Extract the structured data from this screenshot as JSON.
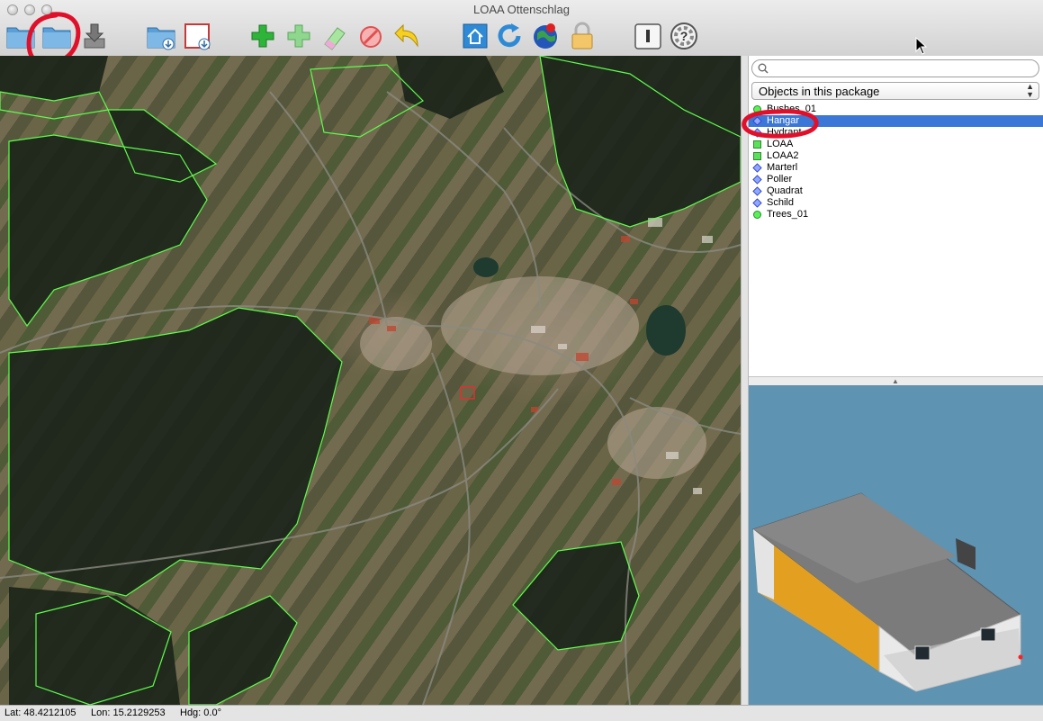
{
  "window": {
    "title": "LOAA Ottenschlag"
  },
  "toolbar": {
    "buttons": [
      {
        "name": "open-folder-icon"
      },
      {
        "name": "open-package-folder-icon"
      },
      {
        "name": "save-download-icon"
      },
      {
        "name": "import-folder-icon"
      },
      {
        "name": "import-frame-icon"
      },
      {
        "name": "add-object-icon"
      },
      {
        "name": "add-multiple-icon"
      },
      {
        "name": "edit-eraser-icon"
      },
      {
        "name": "delete-icon"
      },
      {
        "name": "undo-icon"
      },
      {
        "name": "home-icon"
      },
      {
        "name": "refresh-icon"
      },
      {
        "name": "globe-icon"
      },
      {
        "name": "lock-icon"
      },
      {
        "name": "preferences-icon"
      },
      {
        "name": "help-icon"
      }
    ]
  },
  "search": {
    "placeholder": "",
    "value": ""
  },
  "package_filter": {
    "selected": "Objects in this package"
  },
  "objects": [
    {
      "label": "Bushes_01",
      "type": "pin",
      "selected": false
    },
    {
      "label": "Hangar",
      "type": "dia",
      "selected": true
    },
    {
      "label": "Hydrant",
      "type": "dia",
      "selected": false
    },
    {
      "label": "LOAA",
      "type": "sq",
      "selected": false
    },
    {
      "label": "LOAA2",
      "type": "sq",
      "selected": false
    },
    {
      "label": "Marterl",
      "type": "dia",
      "selected": false
    },
    {
      "label": "Poller",
      "type": "dia",
      "selected": false
    },
    {
      "label": "Quadrat",
      "type": "dia",
      "selected": false
    },
    {
      "label": "Schild",
      "type": "dia",
      "selected": false
    },
    {
      "label": "Trees_01",
      "type": "pin",
      "selected": false
    }
  ],
  "status": {
    "lat": "Lat: 48.4212105",
    "lon": "Lon: 15.2129253",
    "hdg": "Hdg: 0.0°"
  },
  "colors": {
    "selection": "#3b77d6",
    "annotation": "#e0102a",
    "boundary": "#5cff4a",
    "preview_bg": "#5e93b2"
  }
}
